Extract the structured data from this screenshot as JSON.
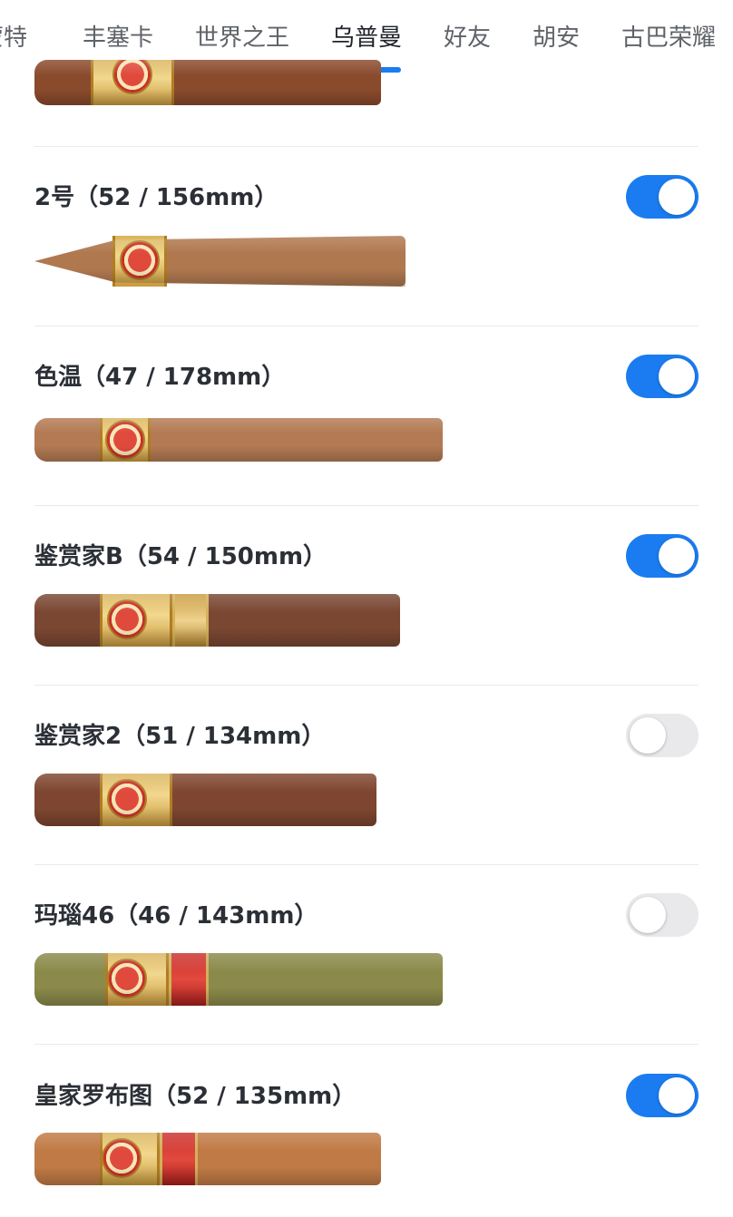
{
  "tabs": [
    {
      "label": "蒙特",
      "active": false
    },
    {
      "label": "丰塞卡",
      "active": false
    },
    {
      "label": "世界之王",
      "active": false
    },
    {
      "label": "乌普曼",
      "active": true
    },
    {
      "label": "好友",
      "active": false
    },
    {
      "label": "胡安",
      "active": false
    },
    {
      "label": "古巴荣耀",
      "active": false
    }
  ],
  "colors": {
    "accent": "#1a7cf0",
    "toggle_off": "#e9e9eb",
    "divider": "#e8eaed"
  },
  "items": [
    {
      "title": "2号（52 / 156mm）",
      "enabled": true,
      "image": "cigar-torpedo-image"
    },
    {
      "title": "色温（47 / 178mm）",
      "enabled": true,
      "image": "cigar-long-image"
    },
    {
      "title": "鉴赏家B（54 / 150mm）",
      "enabled": true,
      "image": "cigar-connoisseur-b-image"
    },
    {
      "title": "鉴赏家2（51 / 134mm）",
      "enabled": false,
      "image": "cigar-connoisseur-2-image"
    },
    {
      "title": "玛瑙46（46 / 143mm）",
      "enabled": false,
      "image": "cigar-magnum-46-image"
    },
    {
      "title": "皇家罗布图（52 / 135mm）",
      "enabled": true,
      "image": "cigar-royal-robusto-image"
    }
  ]
}
